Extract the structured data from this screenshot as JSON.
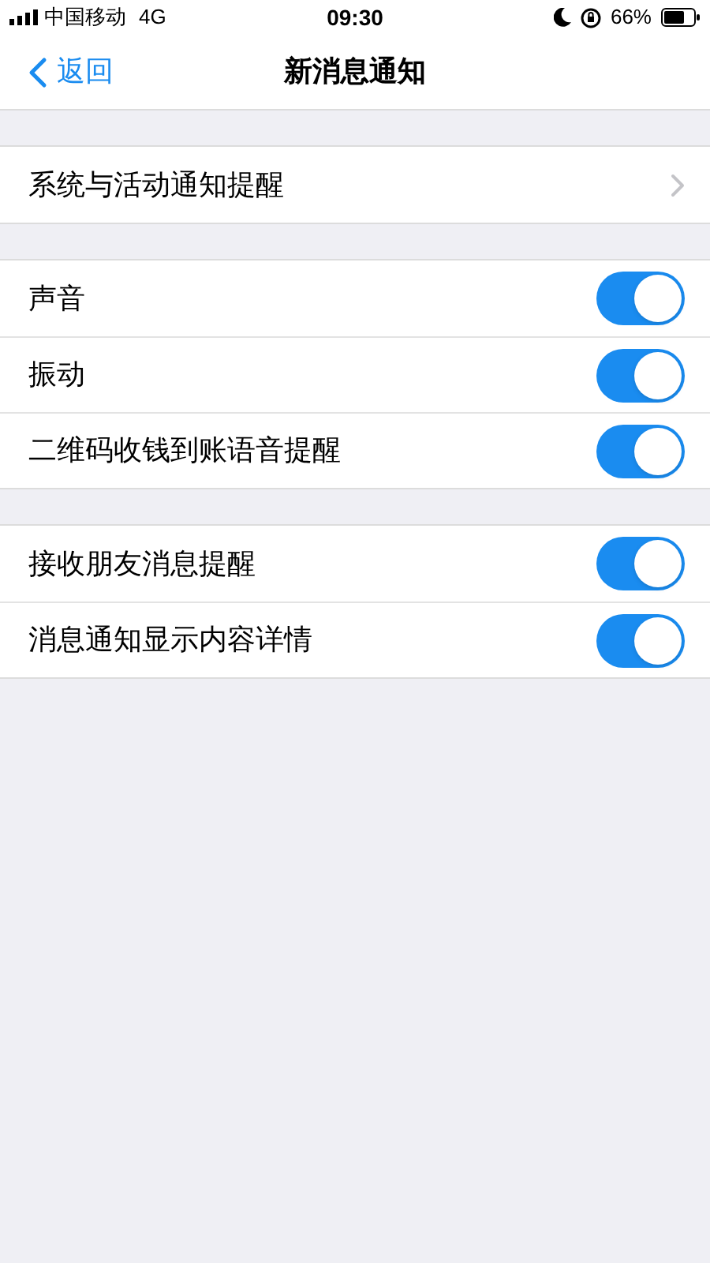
{
  "status_bar": {
    "carrier": "中国移动",
    "network": "4G",
    "time": "09:30",
    "battery": "66%"
  },
  "nav": {
    "back": "返回",
    "title": "新消息通知"
  },
  "sections": [
    {
      "rows": [
        {
          "kind": "link",
          "label": "系统与活动通知提醒"
        }
      ]
    },
    {
      "rows": [
        {
          "kind": "toggle",
          "label": "声音",
          "on": true
        },
        {
          "kind": "toggle",
          "label": "振动",
          "on": true
        },
        {
          "kind": "toggle",
          "label": "二维码收钱到账语音提醒",
          "on": true
        }
      ]
    },
    {
      "rows": [
        {
          "kind": "toggle",
          "label": "接收朋友消息提醒",
          "on": true
        },
        {
          "kind": "toggle",
          "label": "消息通知显示内容详情",
          "on": true
        }
      ]
    }
  ]
}
